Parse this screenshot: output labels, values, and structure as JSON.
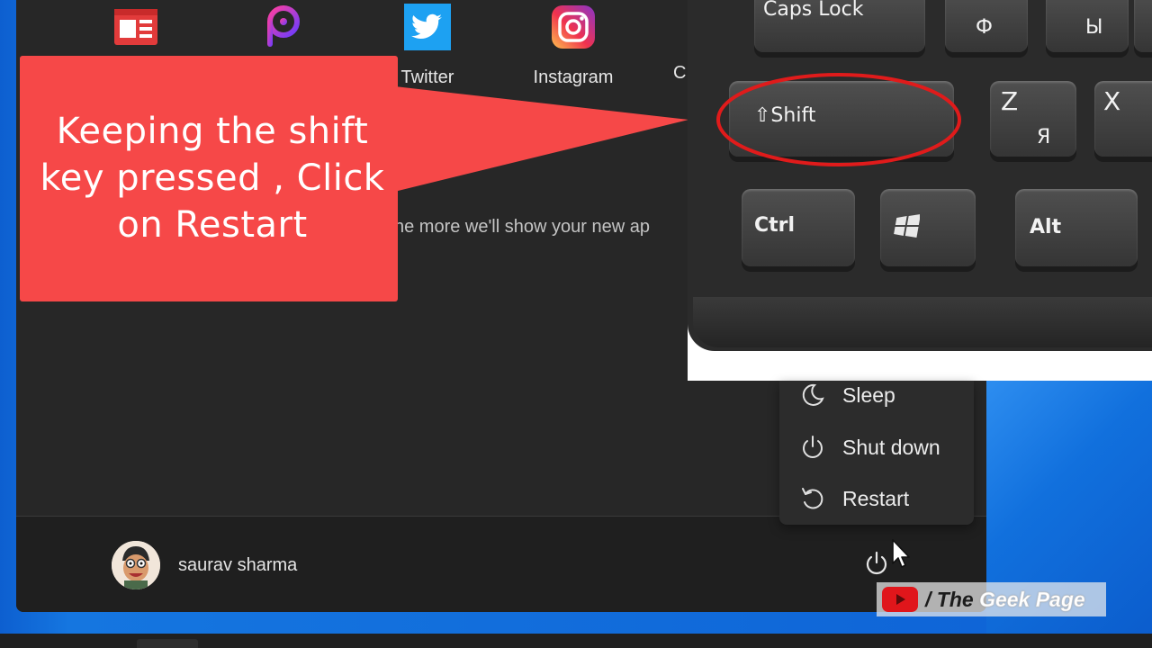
{
  "pinned_apps": [
    {
      "label": "",
      "icon": "news-icon"
    },
    {
      "label": "",
      "icon": "picsart-icon"
    },
    {
      "label": "Twitter",
      "icon": "twitter-icon"
    },
    {
      "label": "Instagram",
      "icon": "instagram-icon"
    },
    {
      "label": "C",
      "icon": "app-icon"
    }
  ],
  "recommended_text": "he more we'll show your new ap",
  "callout_text": "Keeping the shift key pressed , Click on Restart",
  "keyboard": {
    "caps_lock": "Caps Lock",
    "cyr_f": "Ф",
    "cyr_y": "Ы",
    "shift": "⇧Shift",
    "z": "Z",
    "z_cyr": "Я",
    "x": "X",
    "ctrl": "Ctrl",
    "alt": "Alt"
  },
  "power_menu": {
    "sleep": "Sleep",
    "shut_down": "Shut down",
    "restart": "Restart"
  },
  "user": {
    "name": "saurav sharma"
  },
  "watermark": {
    "slash": "/",
    "the": "The",
    "geek_page": "Geek Page"
  },
  "colors": {
    "callout": "#f64848",
    "menu_bg": "#272727",
    "accent": "#0e63d6"
  }
}
